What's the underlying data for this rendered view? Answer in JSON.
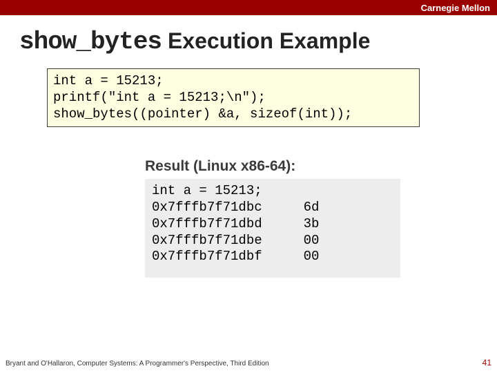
{
  "header": {
    "university": "Carnegie Mellon"
  },
  "title": {
    "mono": "show_bytes",
    "rest": " Execution Example"
  },
  "code": {
    "line1": "int a = 15213;",
    "line2": "printf(\"int a = 15213;\\n\");",
    "line3": "show_bytes((pointer) &a, sizeof(int));"
  },
  "result": {
    "heading": "Result (Linux x86-64):",
    "first_line": "int a = 15213;",
    "rows": [
      {
        "addr": "0x7fffb7f71dbc",
        "val": "6d"
      },
      {
        "addr": "0x7fffb7f71dbd",
        "val": "3b"
      },
      {
        "addr": "0x7fffb7f71dbe",
        "val": "00"
      },
      {
        "addr": "0x7fffb7f71dbf",
        "val": "00"
      }
    ]
  },
  "footer": {
    "attribution": "Bryant and O'Hallaron, Computer Systems: A Programmer's Perspective, Third Edition",
    "page": "41"
  }
}
